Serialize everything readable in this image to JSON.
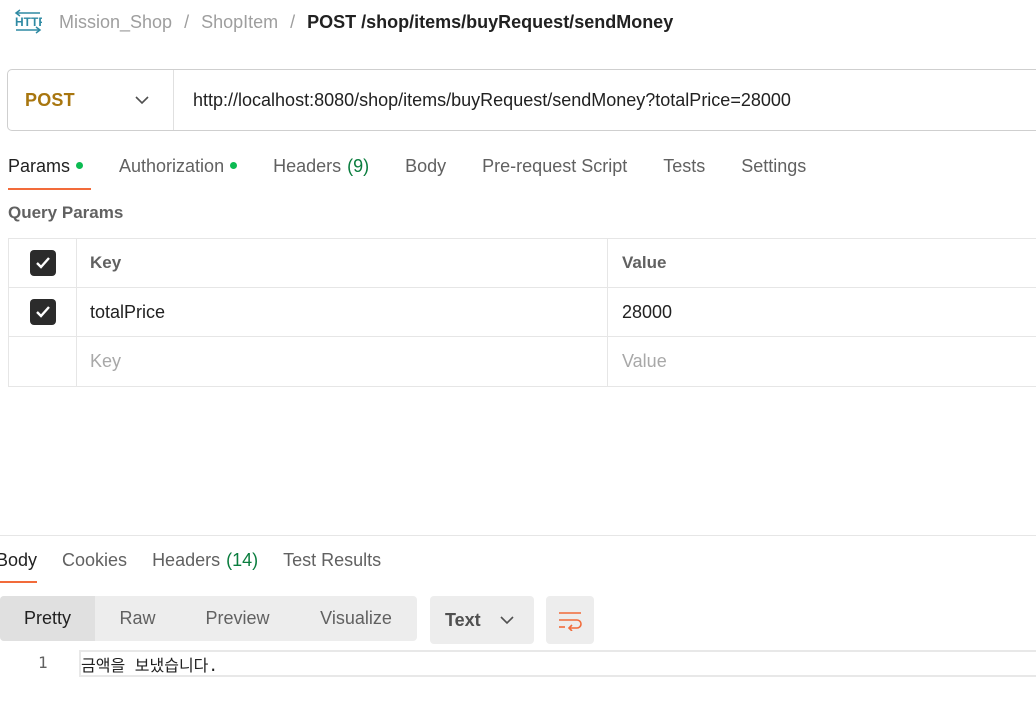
{
  "breadcrumb": {
    "icon": "http-icon",
    "collection": "Mission_Shop",
    "folder": "ShopItem",
    "request": "POST /shop/items/buyRequest/sendMoney",
    "separator": "/"
  },
  "request": {
    "method": "POST",
    "url": "http://localhost:8080/shop/items/buyRequest/sendMoney?totalPrice=28000"
  },
  "request_tabs": [
    {
      "label": "Params",
      "dot": true,
      "active": true
    },
    {
      "label": "Authorization",
      "dot": true
    },
    {
      "label": "Headers",
      "count": "(9)"
    },
    {
      "label": "Body"
    },
    {
      "label": "Pre-request Script"
    },
    {
      "label": "Tests"
    },
    {
      "label": "Settings"
    }
  ],
  "query_params": {
    "title": "Query Params",
    "headers": {
      "key": "Key",
      "value": "Value"
    },
    "rows": [
      {
        "checked": true,
        "key": "totalPrice",
        "value": "28000"
      }
    ],
    "placeholders": {
      "key": "Key",
      "value": "Value"
    }
  },
  "response_tabs": [
    {
      "label": "Body",
      "active": true
    },
    {
      "label": "Cookies"
    },
    {
      "label": "Headers",
      "count": "(14)"
    },
    {
      "label": "Test Results"
    }
  ],
  "response_view": {
    "modes": [
      "Pretty",
      "Raw",
      "Preview",
      "Visualize"
    ],
    "active_mode": "Pretty",
    "format": "Text",
    "wrap_icon": "wrap-lines-icon"
  },
  "response_body": {
    "line_number": "1",
    "content": "금액을 보냈습니다."
  },
  "colors": {
    "accent": "#f26b3a",
    "method": "#a8760f",
    "dot": "#0cbb52",
    "count": "#0a7d3e"
  }
}
